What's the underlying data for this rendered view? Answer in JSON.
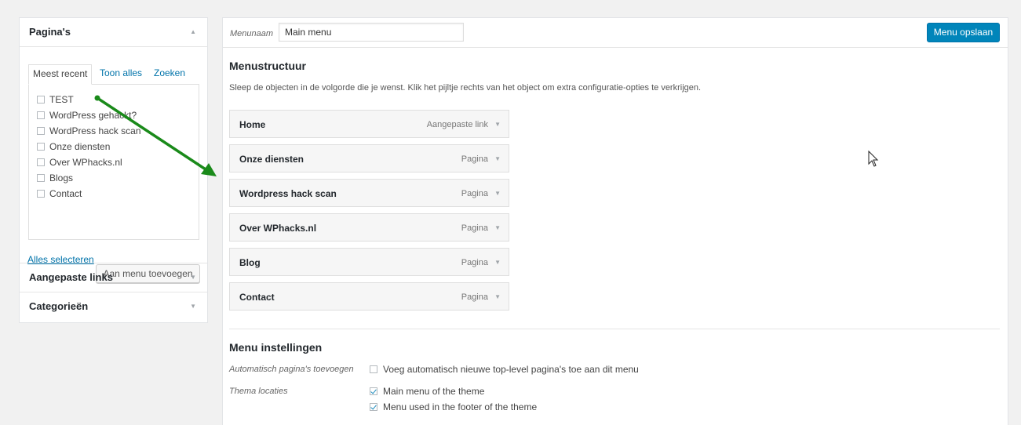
{
  "left": {
    "pages": {
      "title": "Pagina's",
      "tabs": [
        "Meest recent",
        "Toon alles",
        "Zoeken"
      ],
      "items": [
        "TEST",
        "WordPress gehackt?",
        "WordPress hack scan",
        "Onze diensten",
        "Over WPhacks.nl",
        "Blogs",
        "Contact"
      ],
      "select_all": "Alles selecteren",
      "add_button": "Aan menu toevoegen"
    },
    "custom_links": {
      "title": "Aangepaste links"
    },
    "categories": {
      "title": "Categorieën"
    }
  },
  "menu": {
    "name_label": "Menunaam",
    "name_value": "Main menu",
    "save_label": "Menu opslaan",
    "structure_title": "Menustructuur",
    "structure_desc": "Sleep de objecten in de volgorde die je wenst. Klik het pijltje rechts van het object om extra configuratie-opties te verkrijgen.",
    "items": [
      {
        "title": "Home",
        "type": "Aangepaste link"
      },
      {
        "title": "Onze diensten",
        "type": "Pagina"
      },
      {
        "title": "Wordpress hack scan",
        "type": "Pagina"
      },
      {
        "title": "Over WPhacks.nl",
        "type": "Pagina"
      },
      {
        "title": "Blog",
        "type": "Pagina"
      },
      {
        "title": "Contact",
        "type": "Pagina"
      }
    ],
    "settings_title": "Menu instellingen",
    "auto_add_label": "Automatisch pagina's toevoegen",
    "auto_add_option": "Voeg automatisch nieuwe top-level pagina's toe aan dit menu",
    "locations_label": "Thema locaties",
    "locations": [
      {
        "label": "Main menu of the theme",
        "checked": true
      },
      {
        "label": "Menu used in the footer of the theme",
        "checked": true
      }
    ]
  },
  "colors": {
    "accent": "#0085ba",
    "arrow": "#1a8a1a"
  }
}
